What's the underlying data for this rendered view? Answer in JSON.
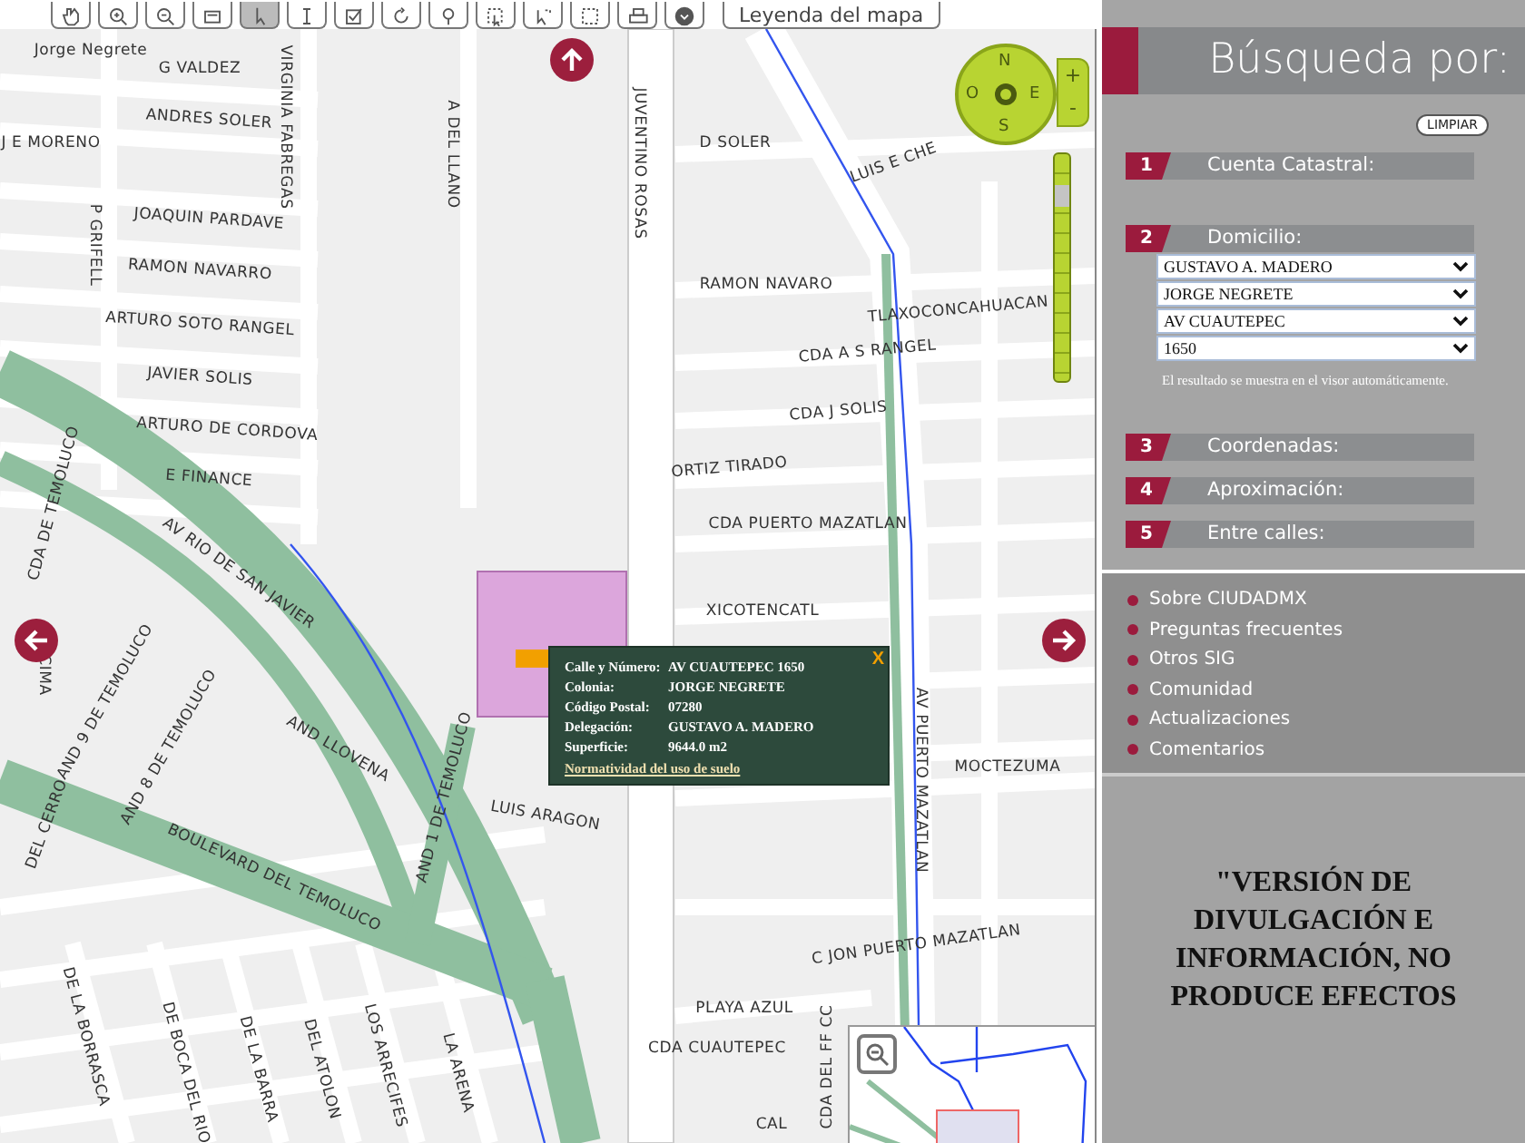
{
  "toolbar": {
    "tools": [
      {
        "selected": false
      },
      {
        "selected": false
      },
      {
        "selected": false
      },
      {
        "selected": false
      },
      {
        "selected": true
      },
      {
        "selected": false
      },
      {
        "selected": false
      },
      {
        "selected": false
      },
      {
        "selected": false
      },
      {
        "selected": false
      },
      {
        "selected": false
      },
      {
        "selected": false
      },
      {
        "selected": false
      },
      {
        "selected": false
      }
    ],
    "legend_button": "Leyenda del mapa"
  },
  "map": {
    "street_labels": [
      "Jorge Negrete",
      "G VALDEZ",
      "ANDRES SOLER",
      "J E MORENO",
      "JOAQUIN PARDAVE",
      "RAMON NAVARRO",
      "ARTURO SOTO RANGEL",
      "JAVIER SOLIS",
      "ARTURO DE CORDOVA",
      "E FINANCE",
      "P GRIFELL",
      "VIRGINIA FABREGAS",
      "A DEL LLANO",
      "JUVENTINO ROSAS",
      "D SOLER",
      "LUIS E CHE",
      "RAMON NAVARO",
      "TLAXOCONCAHUACAN",
      "CDA A S RANGEL",
      "CDA J SOLIS",
      "ORTIZ TIRADO",
      "CDA PUERTO MAZATLAN",
      "XICOTENCATL",
      "AV RIO DE SAN JAVIER",
      "CDA DE TEMOLUCO",
      "CIMA",
      "AND 9 DE TEMOLUCO",
      "AND 8 DE TEMOLUCO",
      "AND LLOVENA",
      "LUIS ARAGON",
      "AV PUERTO MAZATLAN",
      "MOCTEZUMA",
      "BOULEVARD DEL TEMOLUCO",
      "AND 1 DE TEMOLUCO",
      "DEL CERRO",
      "C JON PUERTO MAZATLAN",
      "PLAYA AZUL",
      "CDA CUAUTEPEC",
      "DE LA BORRASCA",
      "DE BOCA DEL RIO",
      "DE LA BARRA",
      "DEL ATOLON",
      "LOS ARRECIFES",
      "LA ARENA",
      "CDA DEL FF CC",
      "CAL"
    ],
    "compass": {
      "north": "N",
      "west": "O",
      "east": "E",
      "south": "S",
      "zoom_in": "+",
      "zoom_out": "-"
    },
    "zoom_slider": {
      "level": 0.85
    },
    "popup": {
      "rows": [
        {
          "label": "Calle y Número:",
          "value": "AV CUAUTEPEC 1650"
        },
        {
          "label": "Colonia:",
          "value": "JORGE NEGRETE"
        },
        {
          "label": "Código Postal:",
          "value": "07280"
        },
        {
          "label": "Delegación:",
          "value": "GUSTAVO A. MADERO"
        },
        {
          "label": "Superficie:",
          "value": "9644.0 m2"
        }
      ],
      "link": "Normatividad del uso de suelo",
      "close": "X"
    }
  },
  "panel": {
    "title": "Búsqueda por:",
    "clear_button": "LIMPIAR",
    "sections": [
      {
        "number": "1",
        "label": "Cuenta Catastral:"
      },
      {
        "number": "2",
        "label": "Domicilio:",
        "selects": [
          "GUSTAVO A. MADERO",
          "JORGE NEGRETE",
          "AV CUAUTEPEC",
          "1650"
        ],
        "note": "El resultado se muestra en el visor automáticamente."
      },
      {
        "number": "3",
        "label": "Coordenadas:"
      },
      {
        "number": "4",
        "label": "Aproximación:"
      },
      {
        "number": "5",
        "label": "Entre calles:"
      }
    ],
    "links": [
      "Sobre CIUDADMX",
      "Preguntas frecuentes",
      "Otros SIG",
      "Comunidad",
      "Actualizaciones",
      "Comentarios"
    ],
    "disclaimer": "\"VERSIÓN DE DIVULGACIÓN E INFORMACIÓN, NO PRODUCE EFECTOS"
  }
}
